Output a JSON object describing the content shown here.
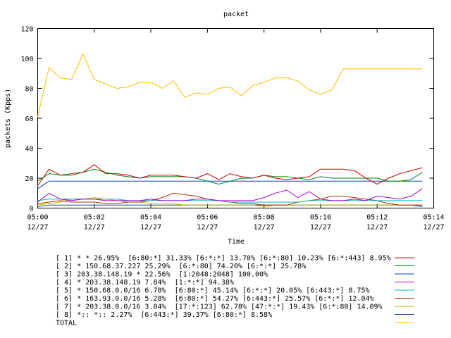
{
  "chart_data": {
    "type": "line",
    "title": "packet",
    "xlabel": "Time",
    "ylabel": "packets (Kpps)",
    "ylim": [
      0,
      120
    ],
    "yticks": [
      0,
      20,
      40,
      60,
      80,
      100,
      120
    ],
    "xlim": [
      0,
      14
    ],
    "xticks": [
      {
        "x": 0,
        "time": "05:00",
        "date": "12/27"
      },
      {
        "x": 2,
        "time": "05:02",
        "date": "12/27"
      },
      {
        "x": 4,
        "time": "05:04",
        "date": "12/27"
      },
      {
        "x": 6,
        "time": "05:06",
        "date": "12/27"
      },
      {
        "x": 8,
        "time": "05:08",
        "date": "12/27"
      },
      {
        "x": 10,
        "time": "05:10",
        "date": "12/27"
      },
      {
        "x": 12,
        "time": "05:12",
        "date": "12/27"
      },
      {
        "x": 14,
        "time": "05:14",
        "date": "12/27"
      }
    ],
    "grid": false,
    "legend_position": "bottom",
    "x": [
      0,
      0.4,
      0.8,
      1.2,
      1.6,
      2,
      2.4,
      2.8,
      3.2,
      3.6,
      4,
      4.4,
      4.8,
      5.2,
      5.6,
      6,
      6.4,
      6.8,
      7.2,
      7.6,
      8,
      8.4,
      8.8,
      9.2,
      9.6,
      10,
      10.4,
      10.8,
      11.2,
      11.6,
      12,
      12.4,
      12.8,
      13.2,
      13.6
    ],
    "series": [
      {
        "name": "[ 1] * * 26.95%  [6:80:*] 31.33% [6:*:*] 13.70% [6:*:80] 10.23% [6:*:443] 8.95%",
        "color": "#cc0000",
        "values": [
          15,
          26,
          22,
          22,
          24,
          29,
          23,
          23,
          22,
          20,
          22,
          22,
          22,
          21,
          20,
          23,
          19,
          23,
          21,
          20,
          22,
          20,
          19,
          20,
          21,
          26,
          26,
          26,
          25,
          20,
          16,
          20,
          23,
          25,
          27
        ]
      },
      {
        "name": "[ 2] * 150.68.37.227 25.29%  [6:*:80] 74.20% [6:*:*] 25.78%",
        "color": "#008800",
        "values": [
          18,
          23,
          22,
          23,
          24,
          26,
          24,
          22,
          21,
          20,
          21,
          21,
          21,
          21,
          20,
          18,
          16,
          18,
          20,
          20,
          22,
          21,
          21,
          20,
          19,
          21,
          20,
          20,
          20,
          20,
          20,
          18,
          18,
          19,
          24
        ]
      },
      {
        "name": "[ 3] 203.38.148.19 * 22.56%  [1:2048:2048] 100.00%",
        "color": "#0044cc",
        "values": [
          13,
          18,
          18,
          18,
          18,
          18,
          18,
          18,
          18,
          18,
          18,
          18,
          18,
          18,
          18,
          18,
          18,
          18,
          18,
          18,
          18,
          18,
          18,
          18,
          18,
          18,
          18,
          18,
          18,
          18,
          18,
          18,
          18,
          18,
          18
        ]
      },
      {
        "name": "[ 4] * 203.38.148.19 7.84%  [1:*:*] 94.38%",
        "color": "#aa00cc",
        "values": [
          4,
          10,
          6,
          5,
          6,
          6,
          5,
          5,
          5,
          5,
          6,
          5,
          5,
          5,
          6,
          6,
          5,
          5,
          5,
          5,
          7,
          10,
          12,
          7,
          11,
          6,
          5,
          5,
          6,
          5,
          8,
          7,
          6,
          8,
          13
        ]
      },
      {
        "name": "[ 5] * 150.68.0.0/16 6.78%  [6:80:*] 45.14% [6:*:*] 20.05% [6:443:*] 8.75%",
        "color": "#00bbbb",
        "values": [
          5,
          6,
          6,
          6,
          6,
          6,
          6,
          6,
          5,
          5,
          5,
          5,
          5,
          5,
          5,
          5,
          5,
          4,
          4,
          4,
          4,
          4,
          4,
          4,
          5,
          5,
          5,
          5,
          5,
          5,
          5,
          5,
          5,
          5,
          5
        ]
      },
      {
        "name": "[ 6] * 163.93.0.0/16 5.28%  [6:80:*] 54.27% [6:443:*] 25.57% [6:*:*] 12.04%",
        "color": "#aa3300",
        "values": [
          3,
          4,
          5,
          4,
          4,
          4,
          3,
          3,
          4,
          4,
          5,
          7,
          10,
          9,
          8,
          6,
          5,
          4,
          3,
          3,
          2,
          2,
          2,
          4,
          5,
          6,
          8,
          8,
          7,
          6,
          5,
          3,
          2,
          2,
          2
        ]
      },
      {
        "name": "[ 7] * 203.38.0.0/16 3.04%  [17:*:123] 62.78% [47:*:*] 19.43% [6:*:80] 14.09%",
        "color": "#bbbb00",
        "values": [
          2,
          3,
          4,
          6,
          6,
          7,
          6,
          5,
          4,
          4,
          3,
          3,
          3,
          2,
          2,
          2,
          2,
          2,
          2,
          2,
          1,
          2,
          2,
          2,
          2,
          2,
          2,
          2,
          2,
          2,
          2,
          2,
          2,
          2,
          2
        ]
      },
      {
        "name": "[ 8] *:: *:: 2.27%  [6:443:*] 39.37% [6:80:*] 8.58%",
        "color": "#224499",
        "values": [
          1,
          2,
          2,
          2,
          2,
          2,
          2,
          2,
          2,
          2,
          2,
          2,
          2,
          2,
          2,
          2,
          2,
          2,
          2,
          2,
          2,
          2,
          2,
          2,
          2,
          2,
          2,
          2,
          2,
          2,
          2,
          2,
          2,
          2,
          1
        ]
      },
      {
        "name": "TOTAL",
        "color": "#ffbb00",
        "values": [
          61,
          94,
          87,
          86,
          103,
          86,
          83,
          80,
          81,
          84,
          84,
          80,
          85,
          74,
          77,
          76,
          80,
          81,
          75,
          82,
          84,
          87,
          87,
          85,
          79,
          76,
          79,
          93,
          93,
          93,
          93,
          93,
          93,
          93,
          93
        ]
      }
    ]
  }
}
